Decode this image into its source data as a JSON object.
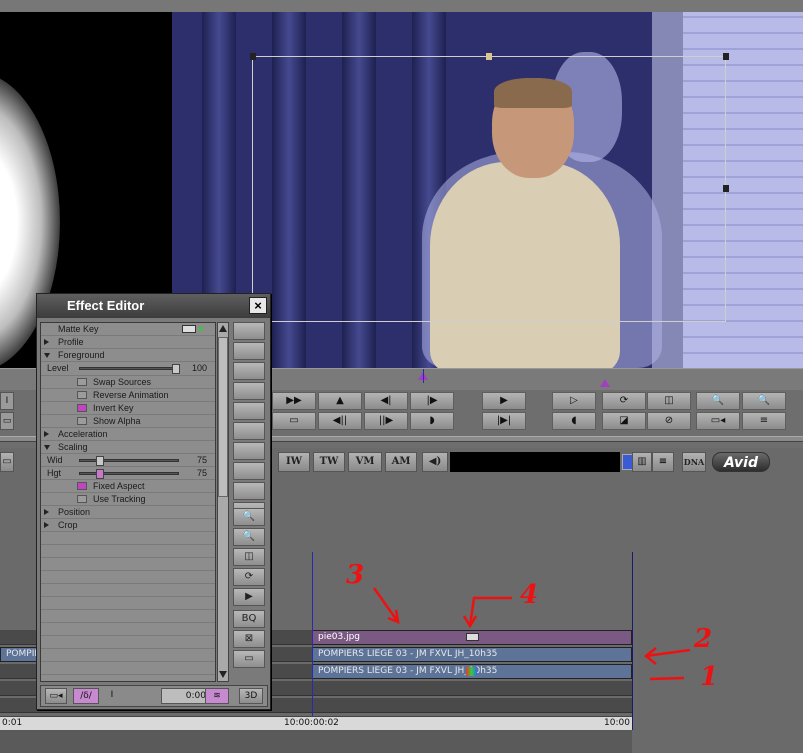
{
  "effect_editor": {
    "title": "Effect Editor",
    "close_label": "×",
    "effect_name": "Matte Key",
    "groups": {
      "profile": "Profile",
      "foreground": "Foreground",
      "acceleration": "Acceleration",
      "scaling": "Scaling",
      "position": "Position",
      "crop": "Crop"
    },
    "level": {
      "label": "Level",
      "value": "100",
      "fraction": 1.0
    },
    "checkboxes": [
      {
        "label": "Swap Sources",
        "checked": false
      },
      {
        "label": "Reverse Animation",
        "checked": false
      },
      {
        "label": "Invert Key",
        "checked": true
      },
      {
        "label": "Show Alpha",
        "checked": false
      }
    ],
    "scaling": {
      "width": {
        "label": "Wid",
        "value": "75",
        "fraction": 0.2
      },
      "height": {
        "label": "Hgt",
        "value": "75",
        "fraction": 0.2
      },
      "fixed_aspect": {
        "label": "Fixed Aspect",
        "checked": true
      },
      "use_tracking": {
        "label": "Use Tracking",
        "checked": false
      }
    },
    "footer_timecode": "0:00",
    "side_buttons": [
      "",
      "",
      "",
      "",
      "",
      "",
      "",
      "",
      "",
      "",
      "",
      "",
      "",
      "",
      "",
      "",
      "",
      "",
      "BQ",
      "",
      "",
      ""
    ]
  },
  "transport": {
    "row1_icons": [
      "fast-forward-icon",
      "mark-in-icon",
      "step-back-icon",
      "step-forward-icon",
      "play-icon",
      "play-forward-icon",
      "loop-icon",
      "split-view-icon",
      "zoom-out-icon",
      "zoom-in-icon"
    ],
    "row2_icons": [
      "frame-icon",
      "step-back-fields-icon",
      "step-forward-fields-icon",
      "half-left-icon",
      "go-to-out-icon",
      "half-right-icon",
      "mask-icon",
      "no-icon",
      "render-icon",
      "menu-icon"
    ],
    "row1_glyphs": [
      "▶▶",
      "▲",
      "◀|",
      "|▶",
      "▶",
      "▷",
      "⟳",
      "◫",
      "🔍",
      "🔍"
    ],
    "row2_glyphs": [
      "▭",
      "◀||",
      "||▶",
      "◗",
      "|▶|",
      "◖",
      "◪",
      "⊘",
      "▭◂",
      "≡"
    ]
  },
  "timeline_toolbar": {
    "buttons": [
      "IW",
      "TW",
      "VM",
      "AM"
    ],
    "logo": "Avid",
    "dna_label": "DNA"
  },
  "timeline": {
    "clips": {
      "v2": "pie03.jpg",
      "v1": "POMPIERS LIEGE 03 - JM FXVL JH_10h35",
      "a1": "POMPIERS LIEGE 03 - JM FXVL JH_10h35",
      "left": "POMPIE"
    },
    "timecodes": [
      "0:01",
      "10:00:00:02",
      "10:00"
    ]
  },
  "annotations": [
    "1",
    "2",
    "3",
    "4"
  ],
  "colors": {
    "annotation": "#ee1111",
    "clip_video": "#7a5a82",
    "clip_audio": "#5d7398",
    "checkbox_on": "#c045c0"
  }
}
